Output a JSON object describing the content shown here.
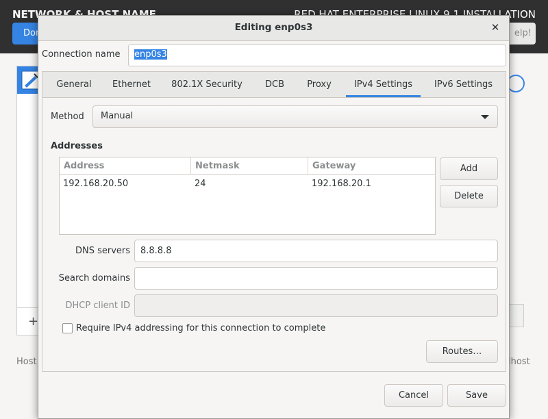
{
  "background": {
    "left_title": "NETWORK & HOST NAME",
    "right_title": "RED HAT ENTERPRISE LINUX 9.1 INSTALLATION",
    "done_label": "Don",
    "help_label": "elp!",
    "add_label": "+",
    "host_label": "Host",
    "host_value": "lhost"
  },
  "dialog": {
    "title": "Editing enp0s3",
    "close_glyph": "✕",
    "connection_name_label": "Connection name",
    "connection_name_value": "enp0s3",
    "tabs": [
      {
        "label": "General"
      },
      {
        "label": "Ethernet"
      },
      {
        "label": "802.1X Security"
      },
      {
        "label": "DCB"
      },
      {
        "label": "Proxy"
      },
      {
        "label": "IPv4 Settings",
        "active": true
      },
      {
        "label": "IPv6 Settings"
      }
    ],
    "ipv4": {
      "method_label": "Method",
      "method_value": "Manual",
      "addresses_heading": "Addresses",
      "columns": [
        "Address",
        "Netmask",
        "Gateway"
      ],
      "rows": [
        {
          "address": "192.168.20.50",
          "netmask": "24",
          "gateway": "192.168.20.1"
        }
      ],
      "add_label": "Add",
      "delete_label": "Delete",
      "dns_label": "DNS servers",
      "dns_value": "8.8.8.8",
      "search_domains_label": "Search domains",
      "search_domains_value": "",
      "dhcp_client_id_label": "DHCP client ID",
      "dhcp_client_id_value": "",
      "require_ipv4_label": "Require IPv4 addressing for this connection to complete",
      "require_ipv4_checked": false,
      "routes_label": "Routes…"
    },
    "cancel_label": "Cancel",
    "save_label": "Save"
  },
  "colors": {
    "accent": "#3584e4",
    "header_bg": "#303030",
    "dialog_bg": "#f6f5f4"
  }
}
